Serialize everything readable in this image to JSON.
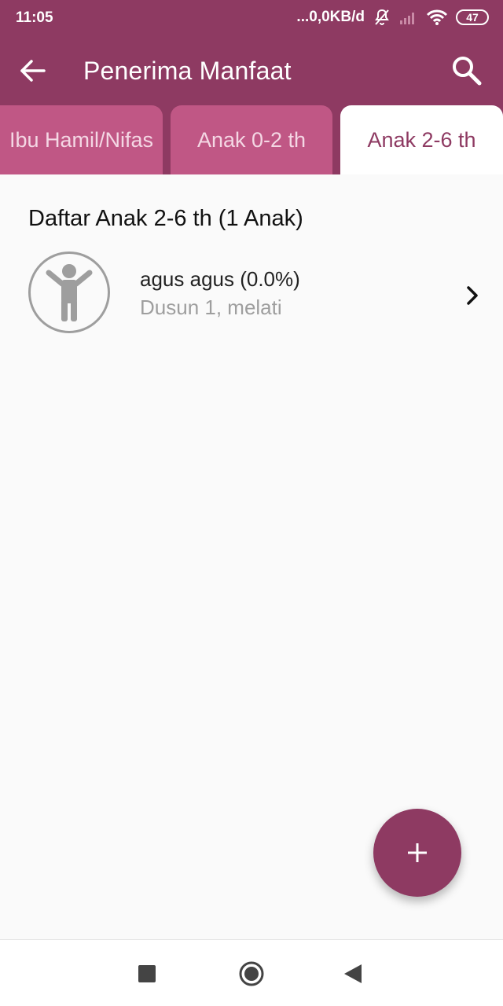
{
  "status_bar": {
    "time": "11:05",
    "network_speed": "...0,0KB/d",
    "battery": "47",
    "icons": [
      "mute-icon",
      "signal-icon",
      "wifi-icon",
      "battery-icon"
    ]
  },
  "app_bar": {
    "title": "Penerima Manfaat",
    "back_icon": "arrow-left-icon",
    "search_icon": "search-icon"
  },
  "tabs": [
    {
      "label": "Ibu Hamil/Nifas",
      "selected": false
    },
    {
      "label": "Anak 0-2 th",
      "selected": false
    },
    {
      "label": "Anak 2-6 th",
      "selected": true
    }
  ],
  "content": {
    "section_title": "Daftar Anak 2-6 th (1 Anak)",
    "items": [
      {
        "name": "agus agus (0.0%)",
        "subtitle": "Dusun 1, melati",
        "icon": "child-icon"
      }
    ]
  },
  "fab": {
    "label": "+",
    "icon": "plus-icon"
  },
  "nav_bar": {
    "icons": [
      "recents-square-icon",
      "home-circle-icon",
      "back-triangle-icon"
    ]
  },
  "colors": {
    "primary": "#8e3a62",
    "tab_inactive": "#c05785",
    "tab_active_bg": "#ffffff",
    "background": "#fafafa"
  }
}
